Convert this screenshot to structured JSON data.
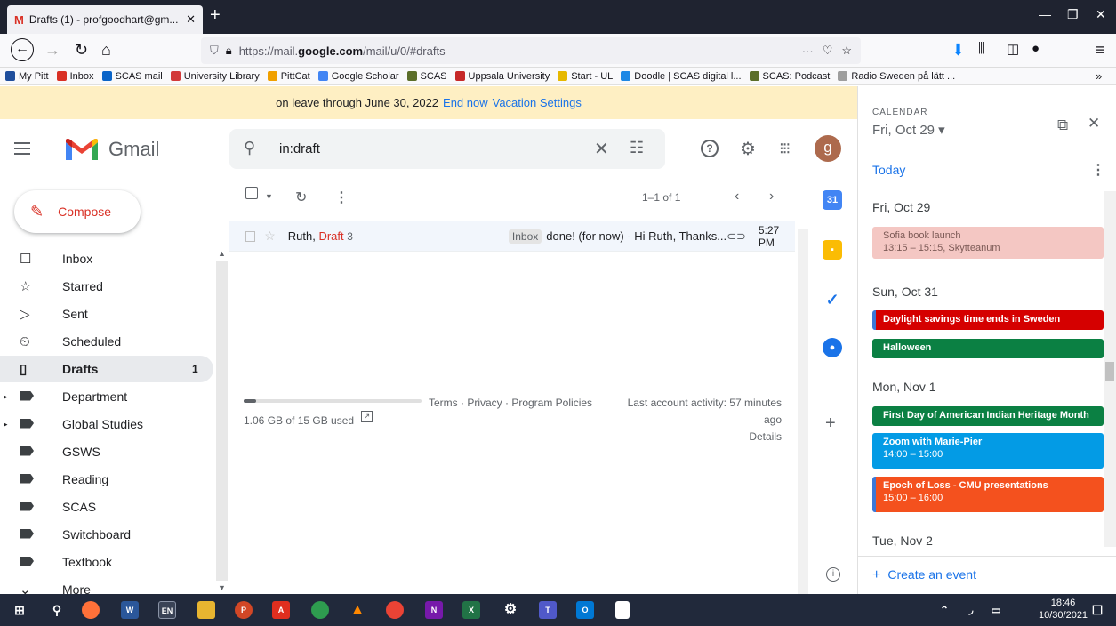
{
  "browser": {
    "tab_title": "Drafts (1) - profgoodhart@gm...",
    "url_prefix": "https://mail.",
    "url_domain": "google.com",
    "url_path": "/mail/u/0/#drafts",
    "bookmarks": [
      {
        "label": "My Pitt",
        "color": "#1f4e9c"
      },
      {
        "label": "Inbox",
        "color": "#d93025"
      },
      {
        "label": "SCAS mail",
        "color": "#0a64c8"
      },
      {
        "label": "University Library",
        "color": "#d23a3a"
      },
      {
        "label": "PittCat",
        "color": "#f0a000"
      },
      {
        "label": "Google Scholar",
        "color": "#4285f4"
      },
      {
        "label": "SCAS",
        "color": "#5b6e2a"
      },
      {
        "label": "Uppsala University",
        "color": "#c62828"
      },
      {
        "label": "Start - UL",
        "color": "#e6b800"
      },
      {
        "label": "Doodle | SCAS digital l...",
        "color": "#1e88e5"
      },
      {
        "label": "SCAS: Podcast",
        "color": "#5b6e2a"
      },
      {
        "label": "Radio Sweden på lätt ...",
        "color": "#9e9e9e"
      }
    ]
  },
  "banner": {
    "text": "on leave through June 30, 2022",
    "end_now": "End now",
    "settings": "Vacation Settings"
  },
  "header": {
    "app_name": "Gmail",
    "search_value": "in:draft",
    "avatar_letter": "g"
  },
  "compose_label": "Compose",
  "sidebar": {
    "items": [
      {
        "label": "Inbox",
        "icon": "inbox-icon",
        "count": ""
      },
      {
        "label": "Starred",
        "icon": "star-icon",
        "count": ""
      },
      {
        "label": "Sent",
        "icon": "send-icon",
        "count": ""
      },
      {
        "label": "Scheduled",
        "icon": "scheduled-icon",
        "count": ""
      },
      {
        "label": "Drafts",
        "icon": "draft-icon",
        "count": "1"
      },
      {
        "label": "Department",
        "icon": "label-icon",
        "count": ""
      },
      {
        "label": "Global Studies",
        "icon": "label-icon",
        "count": ""
      },
      {
        "label": "GSWS",
        "icon": "label-icon",
        "count": ""
      },
      {
        "label": "Reading",
        "icon": "label-icon",
        "count": ""
      },
      {
        "label": "SCAS",
        "icon": "label-icon",
        "count": ""
      },
      {
        "label": "Switchboard",
        "icon": "label-icon",
        "count": ""
      },
      {
        "label": "Textbook",
        "icon": "label-icon",
        "count": ""
      },
      {
        "label": "More",
        "icon": "chevron-down-icon",
        "count": ""
      }
    ]
  },
  "toolbar": {
    "pager": "1–1 of 1"
  },
  "message": {
    "sender": "Ruth,",
    "draft_label": "Draft",
    "count": "3",
    "badge": "Inbox",
    "subject": "done! (for now) - Hi Ruth, Thanks...",
    "time": "5:27 PM"
  },
  "footer": {
    "storage": "1.06 GB of 15 GB used",
    "storage_fraction": 0.07,
    "links": "Terms · Privacy · Program Policies",
    "activity_1": "Last account activity: 57 minutes",
    "activity_2": "ago",
    "details": "Details"
  },
  "calendar": {
    "header": "CALENDAR",
    "date": "Fri, Oct 29",
    "today": "Today",
    "create": "Create an event",
    "days": [
      {
        "label": "Fri, Oct 29"
      },
      {
        "label": "Sun, Oct 31"
      },
      {
        "label": "Mon, Nov 1"
      },
      {
        "label": "Tue, Nov 2"
      }
    ],
    "events": [
      {
        "title": "Sofia book launch",
        "time": "13:15 – 15:15, Skytteanum",
        "color": "#f4c7c3"
      },
      {
        "title": "Daylight savings time ends in Sweden",
        "time": "",
        "color": "#d50000"
      },
      {
        "title": "Halloween",
        "time": "",
        "color": "#0b8043"
      },
      {
        "title": "First Day of American Indian Heritage Month",
        "time": "",
        "color": "#0b8043"
      },
      {
        "title": "Zoom with Marie-Pier",
        "time": "14:00 – 15:00",
        "color": "#039be5"
      },
      {
        "title": "Epoch of Loss - CMU presentations",
        "time": "15:00 – 16:00",
        "color": "#f4511e"
      }
    ]
  },
  "taskbar": {
    "time": "18:46",
    "date": "10/30/2021",
    "lang": "EN"
  }
}
